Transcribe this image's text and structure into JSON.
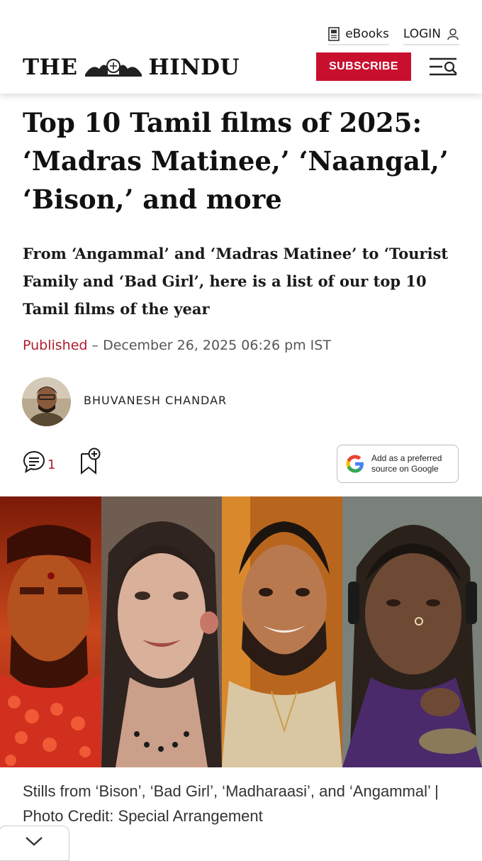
{
  "header": {
    "ebooks_label": "eBooks",
    "login_label": "LOGIN",
    "logo_left": "THE",
    "logo_right": "HINDU",
    "subscribe_label": "SUBSCRIBE"
  },
  "article": {
    "headline": "Top 10 Tamil films of 2025: ‘Madras Matinee,’ ‘Naangal,’ ‘Bison,’ and more",
    "standfirst": "From ‘Angammal’ and ‘Madras Matinee’ to ‘Tourist Family and ‘Bad Girl’, here is a list of our top 10 Tamil films of the year",
    "published_label": "Published",
    "published_date": " – December 26, 2025 06:26 pm IST",
    "author": "BHUVANESH CHANDAR",
    "comment_count": "1",
    "google_line1": "Add as a preferred",
    "google_line2": "source on Google",
    "caption": "Stills from ‘Bison’, ‘Bad Girl’, ‘Madharaasi’, and ‘Angammal’ | Photo Credit: Special Arrangement"
  },
  "colors": {
    "brand_red": "#c8102e",
    "published_red": "#b01c2e"
  },
  "icons": [
    "ebook-icon",
    "user-icon",
    "menu-search-icon",
    "comment-icon",
    "bookmark-add-icon",
    "google-g-icon",
    "chevron-down-icon"
  ]
}
